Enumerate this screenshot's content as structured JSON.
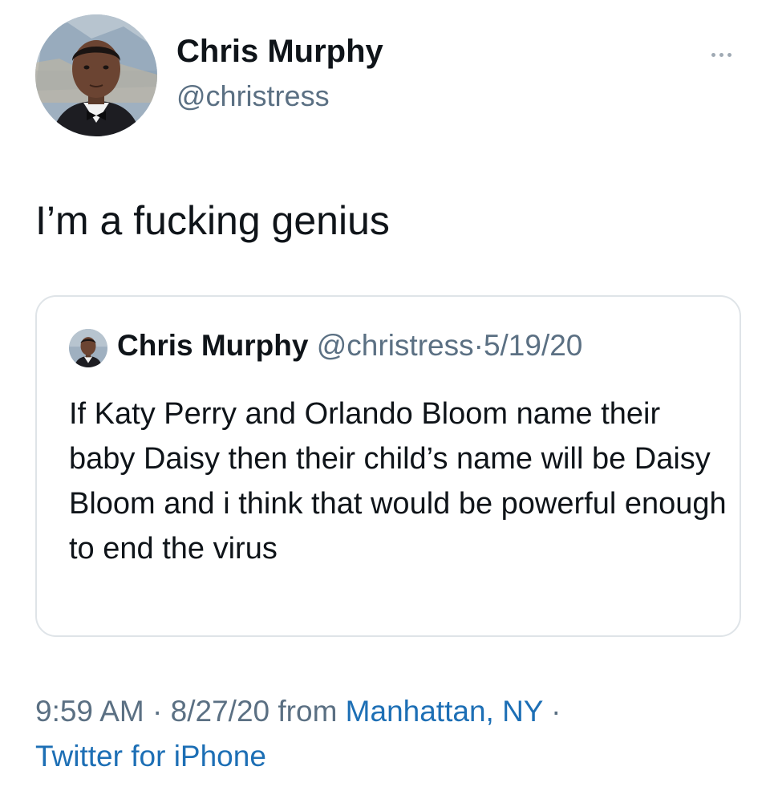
{
  "author": {
    "display_name": "Chris Murphy",
    "handle": "@christress"
  },
  "tweet": {
    "text": "I’m a fucking genius"
  },
  "more_icon": "more-options-icon",
  "quoted_tweet": {
    "display_name": "Chris Murphy",
    "handle": "@christress",
    "separator": "·",
    "date": "5/19/20",
    "text": "If Katy Perry and Orlando Bloom name their baby Daisy then their child’s name will be Daisy Bloom and i think that would be powerful enough to end the virus"
  },
  "footer": {
    "time": "9:59 AM",
    "separator": "·",
    "date": "8/27/20",
    "from_label": "from",
    "location": "Manhattan, NY",
    "separator_end": "·",
    "source": "Twitter for iPhone"
  },
  "colors": {
    "muted_text": "#5b7083",
    "link": "#1d6fb5",
    "border": "#dfe4e8"
  }
}
